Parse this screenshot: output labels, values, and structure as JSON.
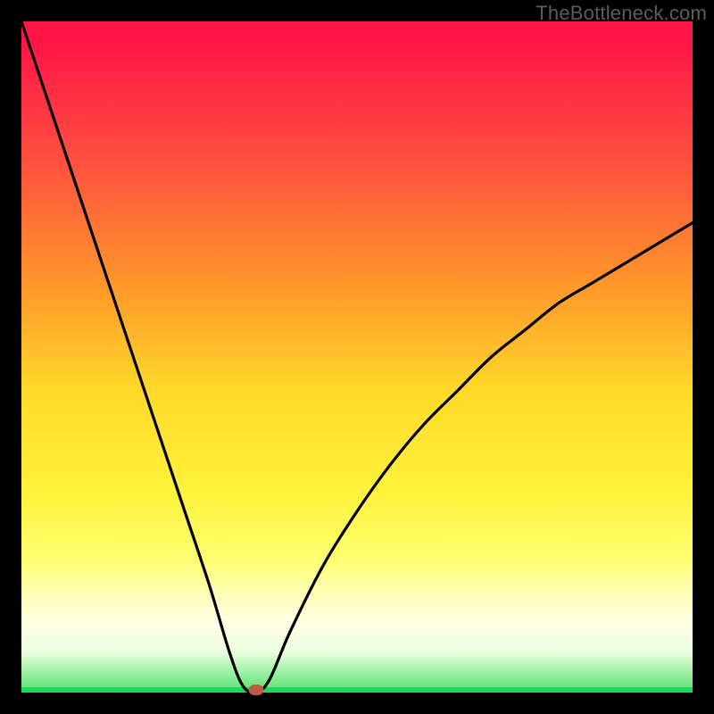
{
  "watermark": "TheBottleneck.com",
  "colors": {
    "frame": "#000000",
    "gradient_top": "#ff1647",
    "gradient_bottom": "#52e06a",
    "curve": "#000000",
    "marker": "#c05a4a"
  },
  "chart_data": {
    "type": "line",
    "title": "",
    "xlabel": "",
    "ylabel": "",
    "xlim": [
      0,
      100
    ],
    "ylim": [
      0,
      100
    ],
    "annotations": [
      "TheBottleneck.com"
    ],
    "marker": {
      "x": 35,
      "y": 0
    },
    "series": [
      {
        "name": "bottleneck-curve",
        "x": [
          0,
          4,
          8,
          12,
          16,
          20,
          24,
          28,
          31,
          33,
          35,
          37,
          40,
          45,
          50,
          55,
          60,
          65,
          70,
          75,
          80,
          85,
          90,
          95,
          100
        ],
        "values": [
          100,
          88,
          76,
          64,
          52,
          40,
          28,
          16,
          6,
          1,
          0,
          2,
          9,
          19,
          27,
          34,
          40,
          45,
          50,
          54,
          58,
          61,
          64,
          67,
          70
        ]
      }
    ]
  }
}
